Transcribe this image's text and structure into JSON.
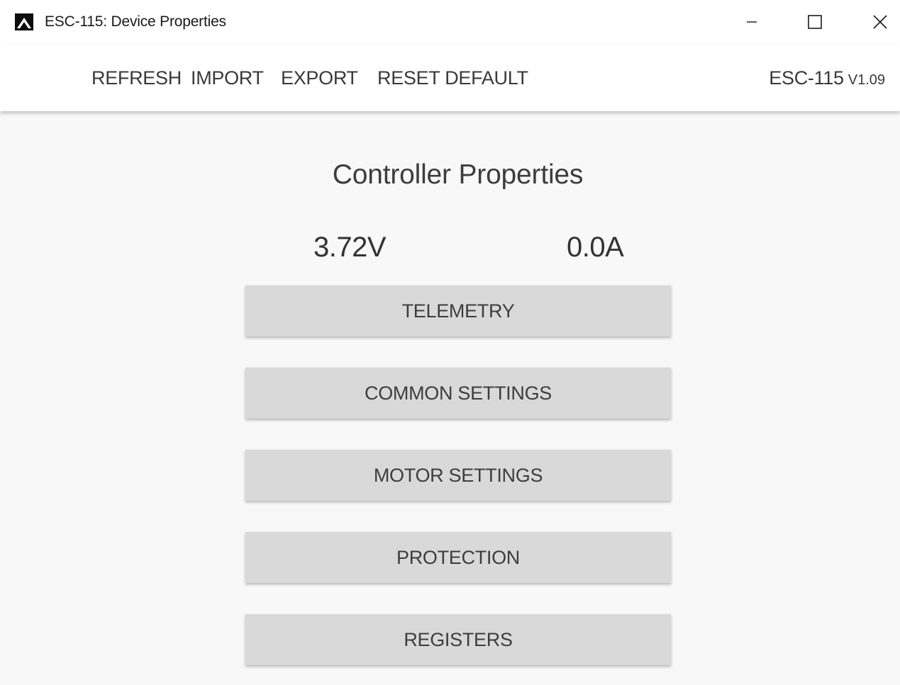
{
  "window": {
    "title": "ESC-115: Device Properties",
    "icon": "app-logo-icon",
    "controls": [
      "minimize-icon",
      "maximize-icon",
      "close-icon"
    ]
  },
  "toolbar": {
    "refresh_label": "REFRESH",
    "import_label": "IMPORT",
    "export_label": "EXPORT",
    "reset_label": "RESET DEFAULT",
    "device_name": "ESC-115",
    "device_version": "V1.09"
  },
  "main": {
    "title": "Controller Properties",
    "voltage": "3.72V",
    "current": "0.0A",
    "menu": [
      {
        "label": "TELEMETRY"
      },
      {
        "label": "COMMON SETTINGS"
      },
      {
        "label": "MOTOR SETTINGS"
      },
      {
        "label": "PROTECTION"
      },
      {
        "label": "REGISTERS"
      }
    ]
  },
  "colors": {
    "background": "#f8f8f8",
    "toolbar_bg": "#ffffff",
    "button_bg": "#d9d9d9",
    "text": "#3c3c3c"
  }
}
